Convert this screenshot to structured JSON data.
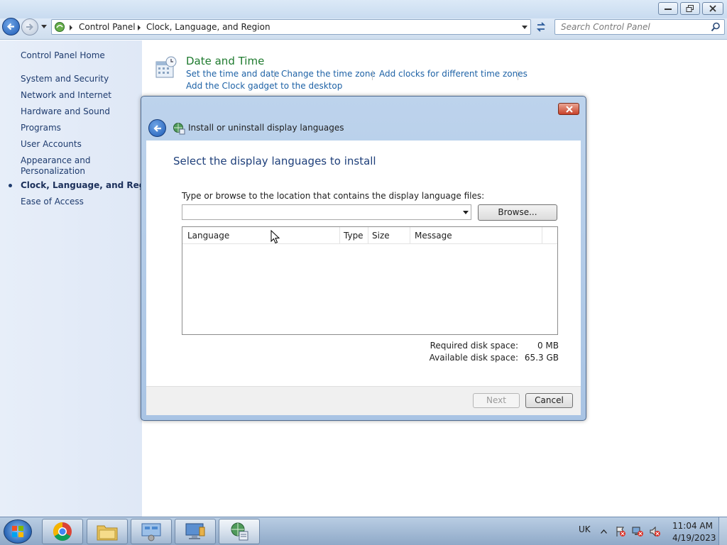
{
  "window": {
    "address": {
      "crumbs": [
        "Control Panel",
        "Clock, Language, and Region"
      ]
    },
    "search_placeholder": "Search Control Panel"
  },
  "sidebar": {
    "home": "Control Panel Home",
    "items": [
      {
        "label": "System and Security"
      },
      {
        "label": "Network and Internet"
      },
      {
        "label": "Hardware and Sound"
      },
      {
        "label": "Programs"
      },
      {
        "label": "User Accounts"
      },
      {
        "label": "Appearance and"
      },
      {
        "label": "Personalization"
      },
      {
        "label": "Clock, Language, and Region",
        "active": true
      },
      {
        "label": "Ease of Access"
      }
    ]
  },
  "category": {
    "title": "Date and Time",
    "links": [
      "Set the time and date",
      "Change the time zone",
      "Add clocks for different time zones",
      "Add the Clock gadget to the desktop"
    ]
  },
  "dialog": {
    "title": "Install or uninstall display languages",
    "heading": "Select the display languages to install",
    "prompt": "Type or browse to the location that contains the display language files:",
    "path_value": "",
    "browse_label": "Browse...",
    "columns": [
      "Language",
      "Type",
      "Size",
      "Message"
    ],
    "required_label": "Required disk space:",
    "required_value": "0 MB",
    "available_label": "Available disk space:",
    "available_value": "65.3 GB",
    "next_label": "Next",
    "cancel_label": "Cancel"
  },
  "taskbar": {
    "language": "UK",
    "time": "11:04 AM",
    "date": "4/19/2023"
  },
  "colors": {
    "link": "#1e62a6",
    "category_title": "#1e7a2e",
    "sidebar_bg": "#e3ebf7",
    "dialog_frame": "#b6cde9",
    "heading": "#1e3f7a"
  },
  "icons": [
    "back-arrow-icon",
    "forward-arrow-icon",
    "control-panel-icon",
    "refresh-icon",
    "search-icon",
    "clock-calendar-icon",
    "globe-icon",
    "chrome-icon",
    "folder-icon",
    "network-icon",
    "computer-icon",
    "flag-icon",
    "volume-muted-icon"
  ]
}
